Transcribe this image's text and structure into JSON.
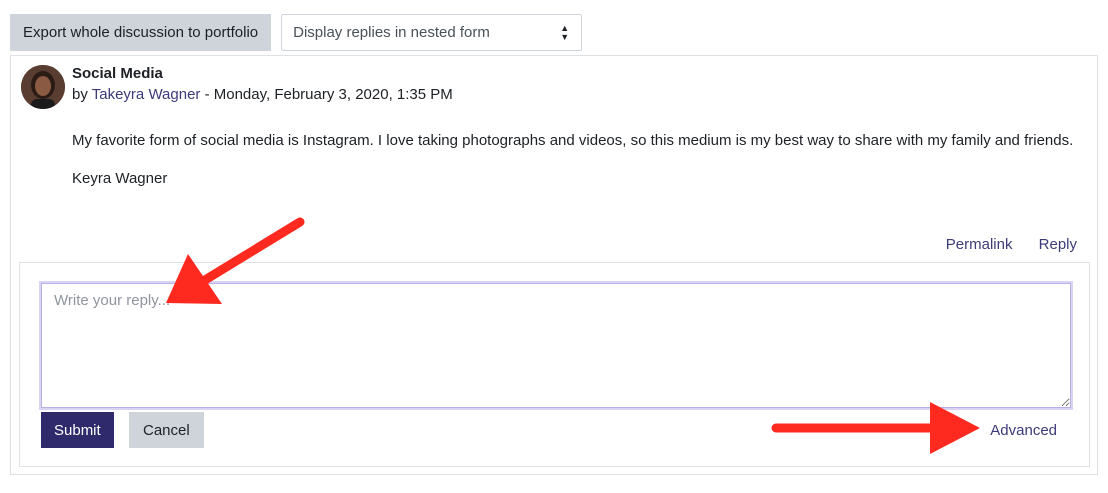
{
  "toolbar": {
    "export_label": "Export whole discussion to portfolio",
    "display_mode_selected": "Display replies in nested form"
  },
  "post": {
    "subject": "Social Media",
    "by_prefix": "by",
    "author": "Takeyra Wagner",
    "date_separator": " - ",
    "date": "Monday, February 3, 2020, 1:35 PM",
    "body": [
      "My favorite form of social media is Instagram. I love taking photographs and videos, so this medium is my best way to share with my family and friends.",
      "Keyra Wagner"
    ],
    "permalink_label": "Permalink",
    "reply_label": "Reply"
  },
  "reply_form": {
    "placeholder": "Write your reply...",
    "submit_label": "Submit",
    "cancel_label": "Cancel",
    "advanced_label": "Advanced"
  },
  "colors": {
    "link": "#3d3a7a",
    "primary": "#2f2a6b",
    "secondary": "#ced4da",
    "annotation_arrow": "#ff2a1f"
  }
}
